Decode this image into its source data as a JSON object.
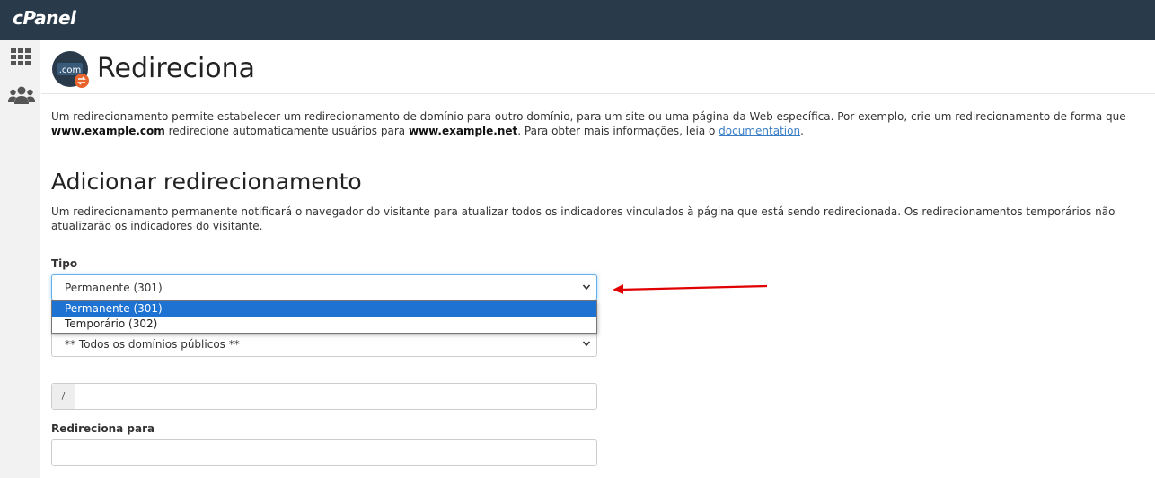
{
  "header": {
    "logo": "cPanel"
  },
  "sidebar": {
    "items": [
      {
        "icon": "grid-icon"
      },
      {
        "icon": "users-icon"
      }
    ]
  },
  "page": {
    "title": "Redireciona",
    "desc_part1": "Um redirecionamento permite estabelecer um redirecionamento de domínio para outro domínio, para um site ou uma página da Web específica. Por exemplo, crie um redirecionamento de forma que ",
    "desc_bold1": "www.example.com",
    "desc_part2": " redirecione automaticamente usuários para ",
    "desc_bold2": "www.example.net",
    "desc_part3": ". Para obter mais informações, leia o ",
    "desc_link": "documentation",
    "desc_part4": "."
  },
  "add_section": {
    "heading": "Adicionar redirecionamento",
    "description": "Um redirecionamento permanente notificará o navegador do visitante para atualizar todos os indicadores vinculados à página que está sendo redirecionada. Os redirecionamentos temporários não atualizarão os indicadores do visitante."
  },
  "form": {
    "type_label": "Tipo",
    "type_selected": "Permanente (301)",
    "type_options": [
      "Permanente (301)",
      "Temporário (302)"
    ],
    "domain_selected": "** Todos os domínios públicos **",
    "path_prefix": "/",
    "path_value": "",
    "redirect_label": "Redireciona para",
    "redirect_value": ""
  },
  "colors": {
    "topbar": "#293a4a",
    "selected_option": "#1e73d2",
    "annotation_arrow": "#e00000"
  }
}
